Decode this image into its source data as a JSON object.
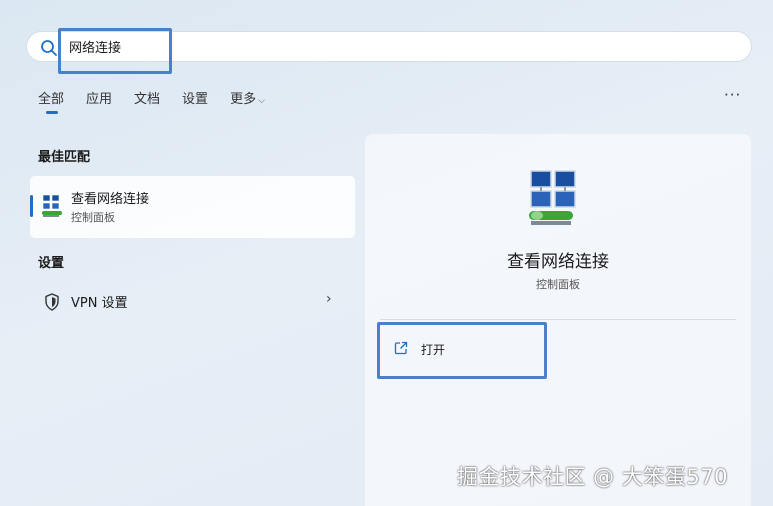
{
  "search": {
    "value": "网络连接",
    "icon": "search-icon"
  },
  "tabs": [
    {
      "label": "全部",
      "active": true
    },
    {
      "label": "应用",
      "active": false
    },
    {
      "label": "文档",
      "active": false
    },
    {
      "label": "设置",
      "active": false
    },
    {
      "label": "更多",
      "active": false,
      "has_dropdown": true
    }
  ],
  "more_menu_label": "···",
  "best_match": {
    "heading": "最佳匹配",
    "item": {
      "title": "查看网络连接",
      "subtitle": "控制面板",
      "icon": "network-connections-icon"
    }
  },
  "settings": {
    "heading": "设置",
    "items": [
      {
        "label": "VPN 设置",
        "icon": "shield-icon",
        "arrow": "›"
      }
    ]
  },
  "detail": {
    "title": "查看网络连接",
    "subtitle": "控制面板",
    "icon": "network-connections-icon",
    "actions": [
      {
        "label": "打开",
        "icon": "external-link-icon"
      }
    ]
  },
  "watermark": "掘金技术社区 @ 大笨蛋570",
  "colors": {
    "accent": "#1f6fc4",
    "highlight_box": "#4a7fc9"
  }
}
